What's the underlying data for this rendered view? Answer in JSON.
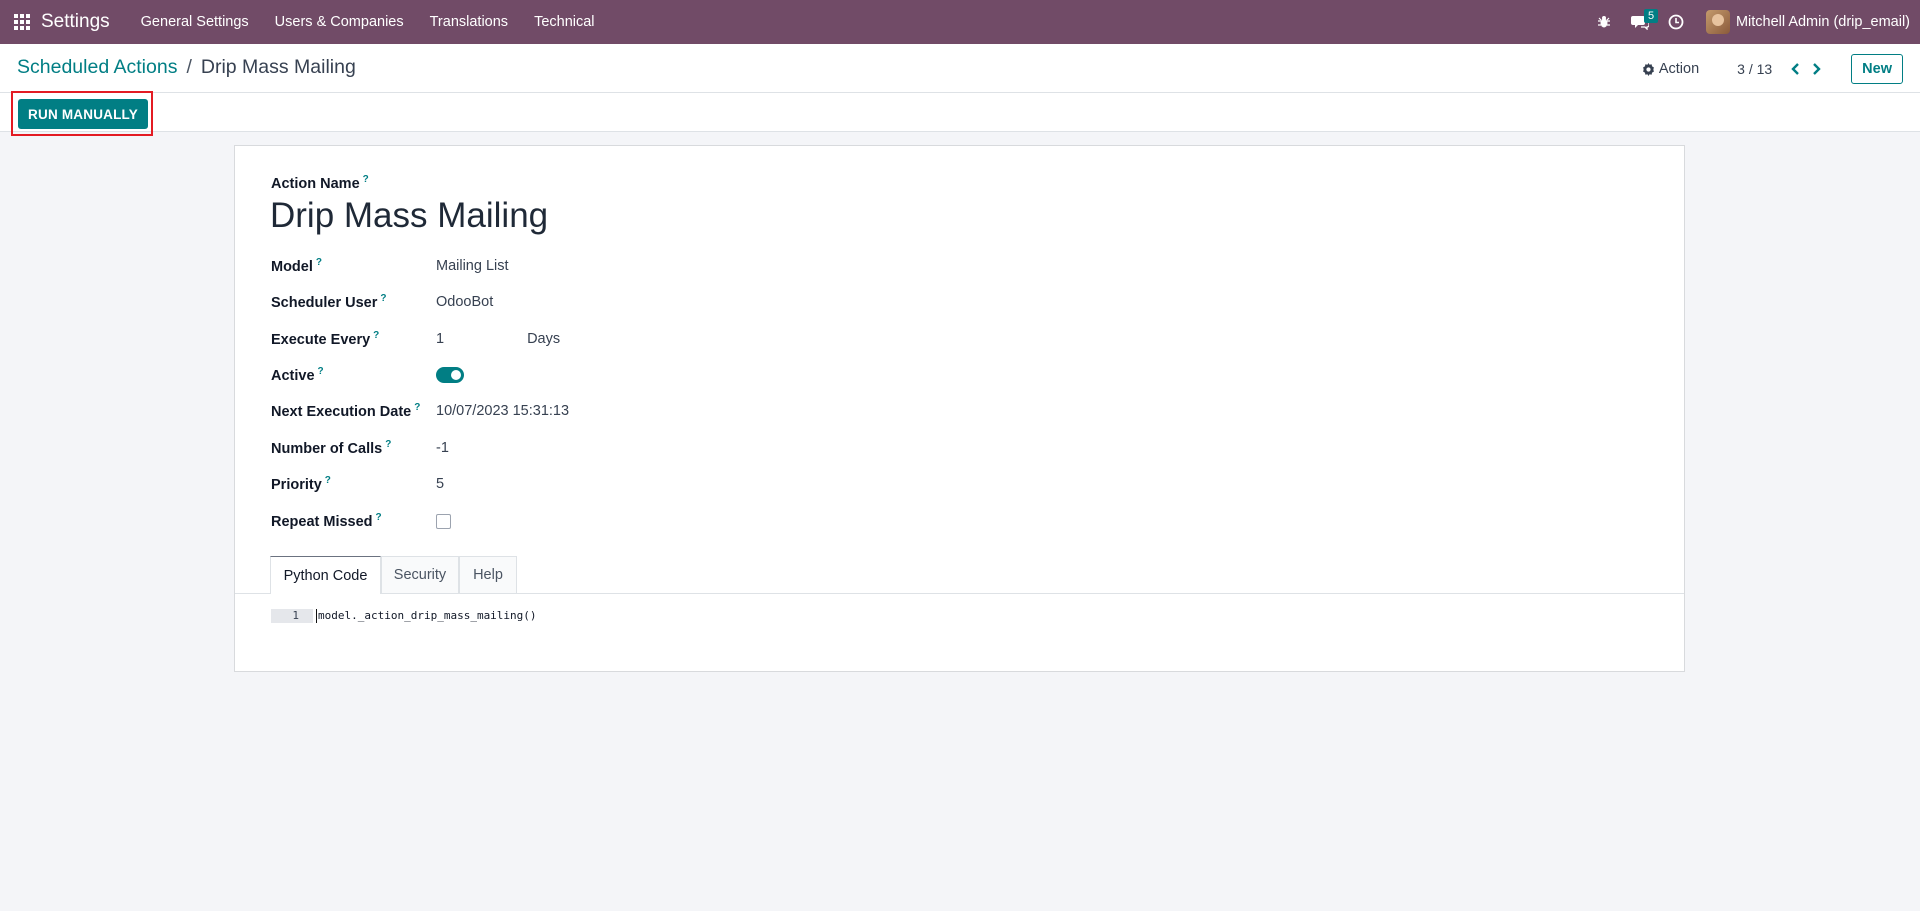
{
  "navbar": {
    "app_name": "Settings",
    "menu": [
      "General Settings",
      "Users & Companies",
      "Translations",
      "Technical"
    ],
    "messages_count": "5",
    "user": "Mitchell Admin (drip_email)",
    "icons": [
      "apps-grid-icon",
      "bug-icon",
      "chat-icon",
      "clock-icon"
    ]
  },
  "control_panel": {
    "breadcrumb_parent": "Scheduled Actions",
    "breadcrumb_separator": "/",
    "breadcrumb_current": "Drip Mass Mailing",
    "action_label": "Action",
    "pager": "3 / 13",
    "new_label": "New",
    "run_manually_label": "RUN MANUALLY"
  },
  "form": {
    "action_name_label": "Action Name",
    "action_name": "Drip Mass Mailing",
    "fields": {
      "model": {
        "label": "Model",
        "value": "Mailing List"
      },
      "scheduler_user": {
        "label": "Scheduler User",
        "value": "OdooBot"
      },
      "execute_every": {
        "label": "Execute Every",
        "value": "1",
        "unit": "Days"
      },
      "active": {
        "label": "Active",
        "value": true
      },
      "next_execution_date": {
        "label": "Next Execution Date",
        "value": "10/07/2023 15:31:13"
      },
      "number_of_calls": {
        "label": "Number of Calls",
        "value": "-1"
      },
      "priority": {
        "label": "Priority",
        "value": "5"
      },
      "repeat_missed": {
        "label": "Repeat Missed",
        "value": false
      }
    },
    "help_mark": "?",
    "tabs": [
      "Python Code",
      "Security",
      "Help"
    ],
    "active_tab": "Python Code",
    "code": {
      "line_number": "1",
      "text": "model._action_drip_mass_mailing()"
    }
  },
  "colors": {
    "navbar": "#714b67",
    "primary": "#017e84",
    "highlight": "#e31b23"
  }
}
